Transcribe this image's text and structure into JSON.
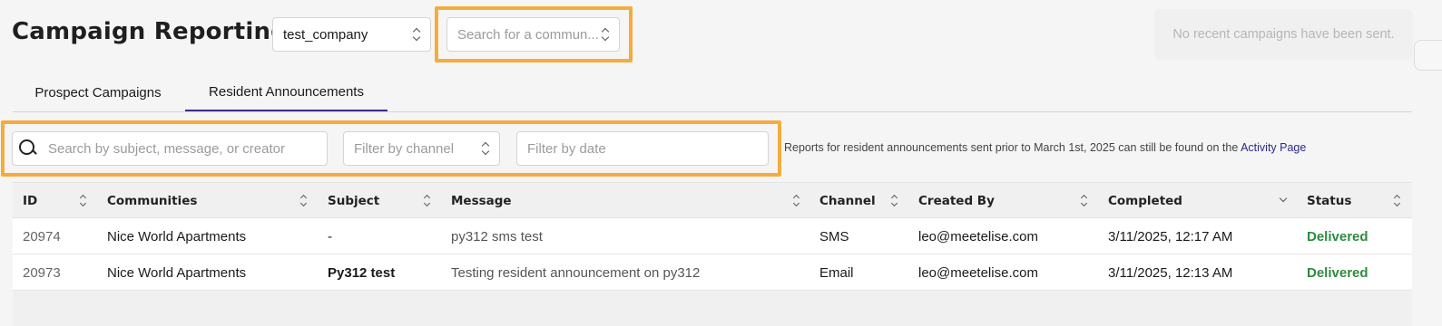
{
  "header": {
    "title": "Campaign Reporting",
    "company_select_value": "test_company",
    "community_search_placeholder": "Search for a commun..."
  },
  "toast": {
    "text": "No recent campaigns have been sent."
  },
  "tabs": [
    {
      "label": "Prospect Campaigns",
      "active": false
    },
    {
      "label": "Resident Announcements",
      "active": true
    }
  ],
  "filters": {
    "search_placeholder": "Search by subject, message, or creator",
    "channel_placeholder": "Filter by channel",
    "date_placeholder": "Filter by date"
  },
  "note": {
    "text": "Reports for resident announcements sent prior to March 1st, 2025 can still be found on the ",
    "link": "Activity Page"
  },
  "table": {
    "columns": [
      "ID",
      "Communities",
      "Subject",
      "Message",
      "Channel",
      "Created By",
      "Completed",
      "Status"
    ],
    "rows": [
      {
        "id": "20974",
        "community": "Nice World Apartments",
        "subject": "-",
        "message": "py312 sms test",
        "channel": "SMS",
        "created_by": "leo@meetelise.com",
        "completed": "3/11/2025, 12:17 AM",
        "status": "Delivered"
      },
      {
        "id": "20973",
        "community": "Nice World Apartments",
        "subject": "Py312 test",
        "message": "Testing resident announcement on py312",
        "channel": "Email",
        "created_by": "leo@meetelise.com",
        "completed": "3/11/2025, 12:13 AM",
        "status": "Delivered"
      }
    ]
  },
  "colors": {
    "highlight": "#f4ac3d",
    "active_tab": "#3a2e8a",
    "link": "#2d2a8c",
    "status_delivered": "#2e8b3e"
  }
}
